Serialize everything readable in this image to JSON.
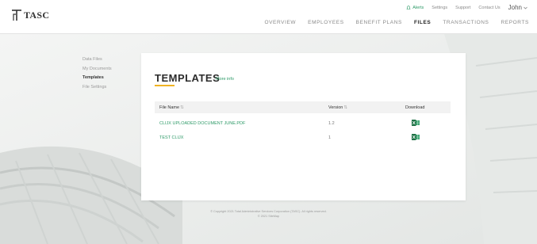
{
  "brand": {
    "name": "TASC"
  },
  "utility": {
    "alerts": "Alerts",
    "settings": "Settings",
    "support": "Support",
    "contact": "Contact Us",
    "user": "John"
  },
  "nav": [
    "OVERVIEW",
    "EMPLOYEES",
    "BENEFIT PLANS",
    "FILES",
    "TRANSACTIONS",
    "REPORTS"
  ],
  "nav_active": "FILES",
  "sidebar": {
    "items": [
      {
        "label": "Data Files",
        "active": false
      },
      {
        "label": "My Documents",
        "active": false
      },
      {
        "label": "Templates",
        "active": true
      },
      {
        "label": "File Settings",
        "active": false
      }
    ]
  },
  "main": {
    "title": "TEMPLATES",
    "more_info": "More info",
    "columns": {
      "name": "File Name",
      "version": "Version",
      "download": "Download"
    },
    "rows": [
      {
        "name": "CLIJX UPLOADED DOCUMENT JUNE.PDF",
        "version": "1.2",
        "download_icon": "excel-icon"
      },
      {
        "name": "TEST CLIJX",
        "version": "1",
        "download_icon": "excel-icon"
      }
    ]
  },
  "footer": {
    "line1": "© Copyright 2021 Total Administrative Services Corporation (TASC). All rights reserved.",
    "line2": "© 2021 SiteMap"
  },
  "colors": {
    "accent": "#2e9a68",
    "underline": "#f0b323"
  }
}
